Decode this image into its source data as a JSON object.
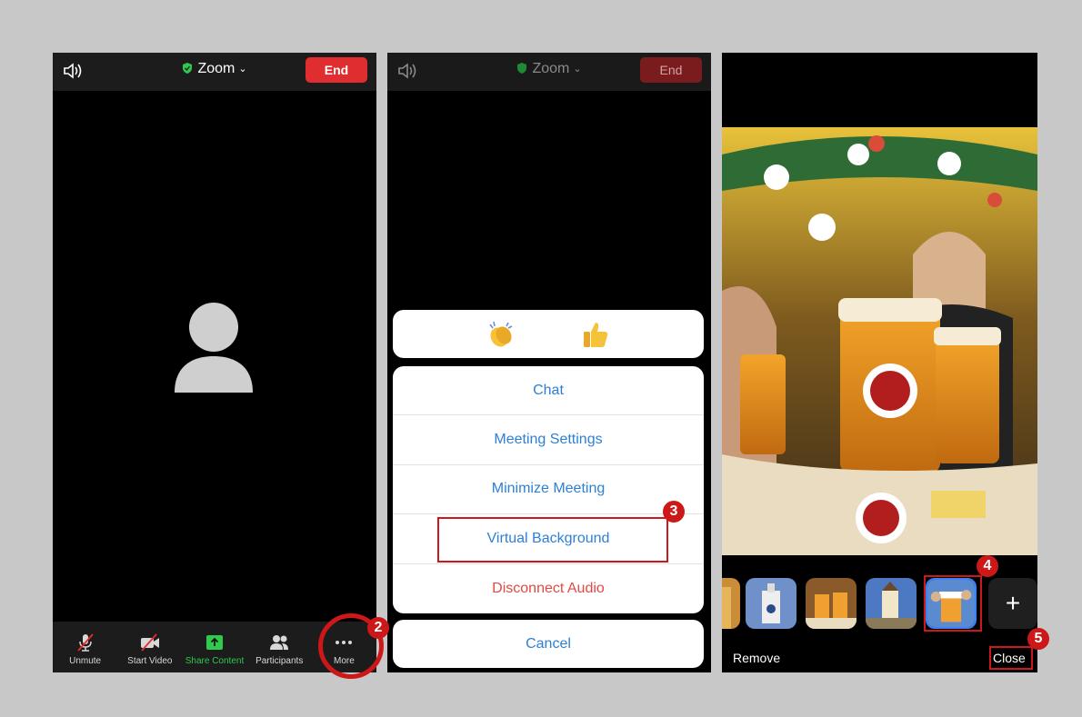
{
  "meeting": {
    "title": "Zoom",
    "end_label": "End"
  },
  "toolbar": {
    "items": [
      {
        "label": "Unmute",
        "icon": "microphone-muted-icon"
      },
      {
        "label": "Start Video",
        "icon": "video-off-icon"
      },
      {
        "label": "Share Content",
        "icon": "share-content-icon"
      },
      {
        "label": "Participants",
        "icon": "participants-icon"
      },
      {
        "label": "More",
        "icon": "more-dots-icon"
      }
    ]
  },
  "reactions": [
    "clapping-hands-icon",
    "thumbs-up-icon"
  ],
  "more_menu": {
    "items": [
      "Chat",
      "Meeting Settings",
      "Minimize Meeting",
      "Virtual Background",
      "Disconnect Audio"
    ],
    "cancel_label": "Cancel"
  },
  "virtual_background": {
    "remove_label": "Remove",
    "close_label": "Close",
    "add_label": "+"
  },
  "step_badges": [
    "2",
    "3",
    "4",
    "5"
  ],
  "colors": {
    "end_red": "#e02d2f",
    "menu_blue": "#2e7fd6",
    "destructive_red": "#e34846",
    "share_green": "#2fc94d",
    "annotation_red": "#cc1818"
  }
}
